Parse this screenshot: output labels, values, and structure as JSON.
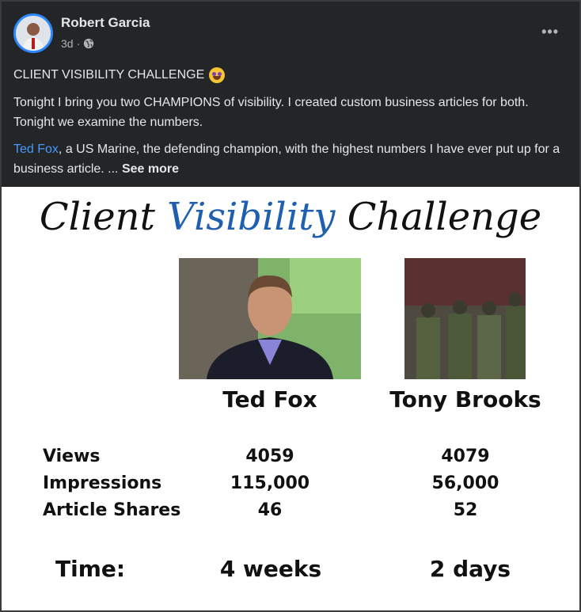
{
  "post": {
    "author": "Robert Garcia",
    "time": "3d",
    "separator": "·",
    "more_label": "•••",
    "heading": "CLIENT VISIBILITY CHALLENGE",
    "paragraph1": "Tonight I bring you two CHAMPIONS of visibility. I created custom business articles for both. Tonight we examine the numbers.",
    "mention": "Ted Fox",
    "paragraph2_rest": ", a US Marine, the defending champion, with the highest numbers I have ever put up for a business article. ... ",
    "see_more": "See more"
  },
  "image": {
    "title_part1": "Client ",
    "title_accent": "Visibility",
    "title_part2": " Challenge",
    "accent_color": "#1f5fb0",
    "contestants": [
      "Ted Fox",
      "Tony Brooks"
    ],
    "stats": {
      "labels": [
        "Views",
        "Impressions",
        "Article Shares"
      ],
      "ted": [
        "4059",
        "115,000",
        "46"
      ],
      "tony": [
        "4079",
        "56,000",
        "52"
      ]
    },
    "time_label": "Time:",
    "time": [
      "4 weeks",
      "2 days"
    ]
  }
}
